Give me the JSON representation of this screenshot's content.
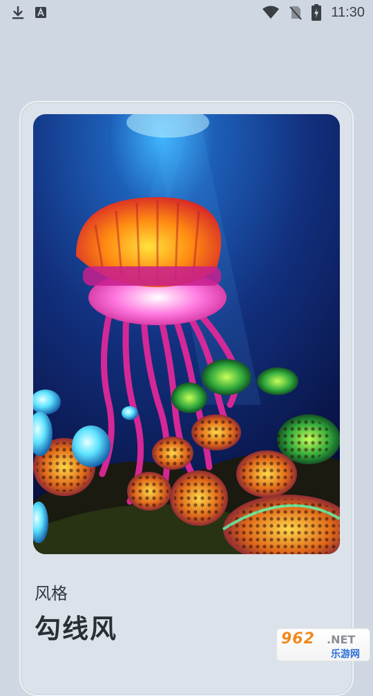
{
  "status_bar": {
    "time": "11:30",
    "left_icons": [
      "download-icon",
      "a-notification-icon"
    ],
    "right_icons": [
      "wifi-icon",
      "no-sim-icon",
      "battery-charging-icon"
    ]
  },
  "card": {
    "style_label": "风格",
    "style_name": "勾线风"
  },
  "watermark": {
    "brand_number": "962",
    "brand_suffix": ".NET",
    "brand_text": "乐游网"
  },
  "colors": {
    "background": "#cfd8e2",
    "card": "#dbe2ea",
    "ocean_dark": "#0a1a5a",
    "jelly_bell": "#f2641a",
    "tentacle": "#e0289a"
  }
}
